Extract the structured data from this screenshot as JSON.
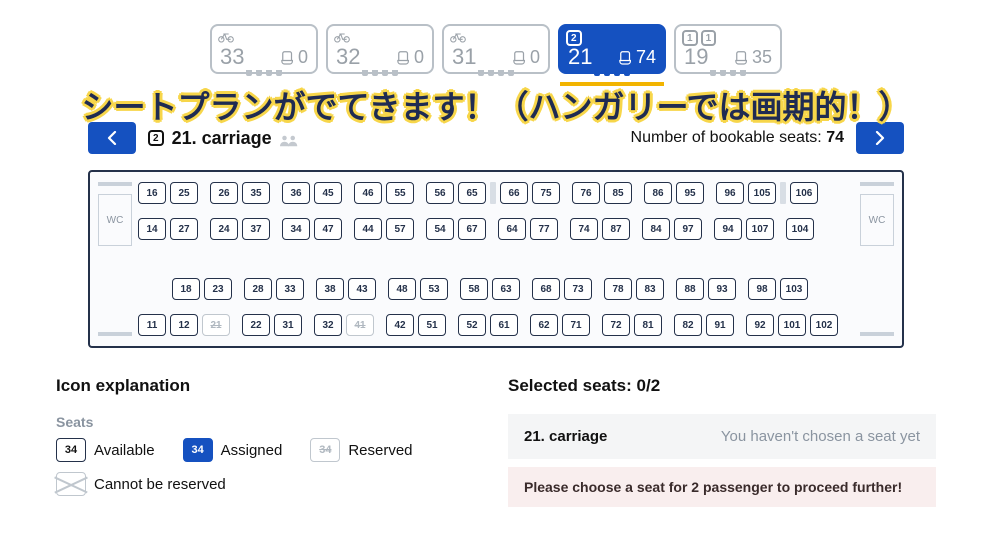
{
  "overlay": "シートプランがでてきます！（ハンガリーでは画期的！）",
  "picker": {
    "cards": [
      {
        "class": null,
        "bike": true,
        "number": "33",
        "seats": "0",
        "active": false
      },
      {
        "class": null,
        "bike": true,
        "number": "32",
        "seats": "0",
        "active": false
      },
      {
        "class": null,
        "bike": true,
        "number": "31",
        "seats": "0",
        "active": false
      },
      {
        "class": "2",
        "bike": false,
        "number": "21",
        "seats": "74",
        "active": true
      },
      {
        "class": "1+1",
        "bike": false,
        "number": "19",
        "seats": "35",
        "active": false
      }
    ]
  },
  "nav": {
    "carriage_class": "2",
    "carriage_label": "21. carriage",
    "bookable_label_pre": "Number of bookable seats:",
    "bookable_count": "74"
  },
  "car": {
    "wc_label": "WC",
    "rows": {
      "r1": [
        "16",
        "25",
        "-",
        "26",
        "35",
        "-",
        "36",
        "45",
        "-",
        "46",
        "55",
        "-",
        "56",
        "65",
        "T",
        "66",
        "75",
        "-",
        "76",
        "85",
        "-",
        "86",
        "95",
        "-",
        "96",
        "105",
        "T",
        "106"
      ],
      "r2": [
        "14",
        "27",
        "-",
        "24",
        "37",
        "-",
        "34",
        "47",
        "-",
        "44",
        "57",
        "-",
        "54",
        "67",
        "-",
        "64",
        "77",
        "-",
        "74",
        "87",
        "-",
        "84",
        "97",
        "-",
        "94",
        "107",
        "-",
        "104"
      ],
      "r3": [
        "-",
        "18",
        "23",
        "-",
        "28",
        "33",
        "-",
        "38",
        "43",
        "-",
        "48",
        "53",
        "-",
        "58",
        "63",
        "-",
        "68",
        "73",
        "-",
        "78",
        "83",
        "-",
        "88",
        "93",
        "-",
        "98",
        "103",
        "-"
      ],
      "r4": [
        "11",
        "12",
        "R21",
        "-",
        "22",
        "31",
        "-",
        "32",
        "R41",
        "-",
        "42",
        "51",
        "-",
        "52",
        "61",
        "-",
        "62",
        "71",
        "-",
        "72",
        "81",
        "-",
        "82",
        "91",
        "-",
        "92",
        "101",
        "102"
      ]
    }
  },
  "legend": {
    "title": "Icon explanation",
    "seats_header": "Seats",
    "available_num": "34",
    "available": "Available",
    "assigned_num": "34",
    "assigned": "Assigned",
    "reserved_num": "34",
    "reserved": "Reserved",
    "cannot": "Cannot be reserved"
  },
  "selection": {
    "title_pre": "Selected seats:",
    "count": "0/2",
    "card_name": "21. carriage",
    "card_msg": "You haven't chosen a seat yet",
    "alert": "Please choose a seat for 2 passenger to proceed further!"
  }
}
